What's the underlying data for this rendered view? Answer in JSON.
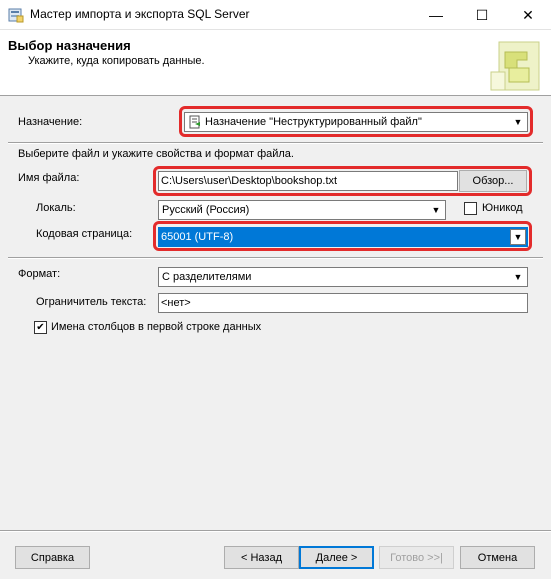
{
  "window": {
    "title": "Мастер импорта и экспорта SQL Server",
    "icons": {
      "app": "wizard-icon",
      "min": "minimize-icon",
      "max": "maximize-icon",
      "close": "close-icon"
    },
    "min_glyph": "—",
    "max_glyph": "☐",
    "close_glyph": "✕"
  },
  "header": {
    "title": "Выбор назначения",
    "subtitle": "Укажите, куда копировать данные."
  },
  "destination": {
    "label": "Назначение:",
    "value": "Назначение \"Неструктурированный файл\""
  },
  "instructions": "Выберите файл и укажите свойства и формат файла.",
  "file": {
    "label": "Имя файла:",
    "value": "C:\\Users\\user\\Desktop\\bookshop.txt",
    "browse_label": "Обзор..."
  },
  "locale": {
    "label": "Локаль:",
    "value": "Русский (Россия)",
    "unicode_label": "Юникод",
    "unicode_checked": false
  },
  "codepage": {
    "label": "Кодовая страница:",
    "value": "65001 (UTF-8)"
  },
  "format": {
    "label": "Формат:",
    "value": "С разделителями"
  },
  "text_qualifier": {
    "label": "Ограничитель текста:",
    "value": "<нет>"
  },
  "column_names": {
    "label": "Имена столбцов в первой строке данных",
    "checked": true,
    "check_glyph": "✔"
  },
  "buttons": {
    "help": "Справка",
    "back": "< Назад",
    "next": "Далее >",
    "finish": "Готово >>|",
    "cancel": "Отмена"
  },
  "colors": {
    "highlight_red": "#e32b2b",
    "selection_blue": "#0078d7"
  }
}
